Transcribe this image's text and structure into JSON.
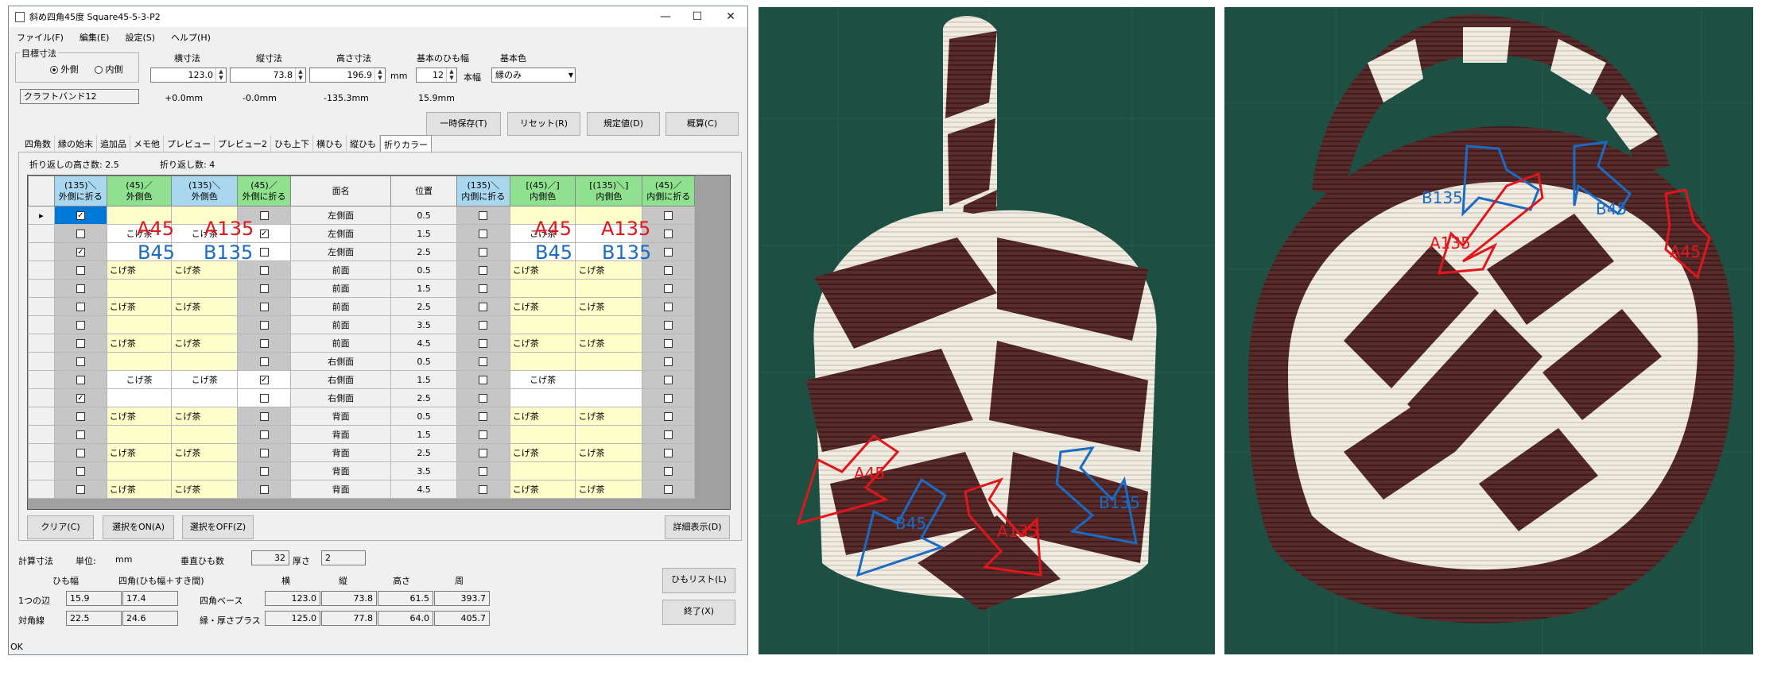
{
  "window": {
    "title": "斜め四角45度 Square45-5-3-P2",
    "min": "—",
    "max": "☐",
    "close": "✕"
  },
  "menu": [
    "ファイル(F)",
    "編集(E)",
    "設定(S)",
    "ヘルプ(H)"
  ],
  "target_group": {
    "legend": "目標寸法",
    "outer": "外側",
    "inner": "内側"
  },
  "fields": {
    "width_label": "横寸法",
    "width_value": "123.0",
    "depth_label": "縦寸法",
    "depth_value": "73.8",
    "height_label": "高さ寸法",
    "height_value": "196.9",
    "unit_mm": "mm",
    "band_label": "基本のひも幅",
    "band_value": "12",
    "band_unit": "本幅",
    "color_label": "基本色",
    "color_value": "縁のみ",
    "material": "クラフトバンド12",
    "diff_w": "+0.0mm",
    "diff_d": "-0.0mm",
    "diff_h": "-135.3mm",
    "band_mm": "15.9mm"
  },
  "buttons": {
    "save_tmp": "一時保存(T)",
    "reset": "リセット(R)",
    "default": "規定値(D)",
    "calc": "概算(C)",
    "clear": "クリア(C)",
    "sel_on": "選択をON(A)",
    "sel_off": "選択をOFF(Z)",
    "detail": "詳細表示(D)",
    "list": "ひもリスト(L)",
    "exit": "終了(X)"
  },
  "tabs": [
    "四角数",
    "縁の始末",
    "追加品",
    "メモ他",
    "プレビュー",
    "プレビュー2",
    "ひも上下",
    "横ひも",
    "縦ひも",
    "折りカラー"
  ],
  "fold_info": {
    "height_count": "折り返しの高さ数: 2.5",
    "count": "折り返し数: 4"
  },
  "grid": {
    "headers": [
      "(135)＼\n外側に折る",
      "(45)／\n外側色",
      "(135)＼\n外側色",
      "(45)／\n外側に折る",
      "面名",
      "位置",
      "(135)＼\n内側に折る",
      "[(45)／]\n内側色",
      "[(135)＼]\n内側色",
      "(45)／\n内側に折る"
    ],
    "rows": [
      {
        "c1": "",
        "f1": true,
        "oc45": "",
        "oc135": "",
        "f2": false,
        "face": "左側面",
        "pos": "0.5",
        "f3": false,
        "ic45": "",
        "ic135": "",
        "f4": false,
        "sel": true
      },
      {
        "c1": "",
        "f1": false,
        "oc45": "こげ茶",
        "oc135": "こげ茶",
        "f2": true,
        "face": "左側面",
        "pos": "1.5",
        "f3": false,
        "ic45": "こげ茶",
        "ic135": "",
        "f4": false,
        "hl": true
      },
      {
        "f1": true,
        "oc45": "",
        "oc135": "",
        "f2": false,
        "face": "左側面",
        "pos": "2.5",
        "f3": false,
        "ic45": "",
        "ic135": "",
        "f4": false,
        "hl": true
      },
      {
        "f1": false,
        "oc45": "こげ茶",
        "oc135": "こげ茶",
        "f2": false,
        "face": "前面",
        "pos": "0.5",
        "f3": false,
        "ic45": "こげ茶",
        "ic135": "こげ茶",
        "f4": false
      },
      {
        "f1": false,
        "oc45": "",
        "oc135": "",
        "f2": false,
        "face": "前面",
        "pos": "1.5",
        "f3": false,
        "ic45": "",
        "ic135": "",
        "f4": false
      },
      {
        "f1": false,
        "oc45": "こげ茶",
        "oc135": "こげ茶",
        "f2": false,
        "face": "前面",
        "pos": "2.5",
        "f3": false,
        "ic45": "こげ茶",
        "ic135": "こげ茶",
        "f4": false
      },
      {
        "f1": false,
        "oc45": "",
        "oc135": "",
        "f2": false,
        "face": "前面",
        "pos": "3.5",
        "f3": false,
        "ic45": "",
        "ic135": "",
        "f4": false
      },
      {
        "f1": false,
        "oc45": "こげ茶",
        "oc135": "こげ茶",
        "f2": false,
        "face": "前面",
        "pos": "4.5",
        "f3": false,
        "ic45": "こげ茶",
        "ic135": "こげ茶",
        "f4": false
      },
      {
        "f1": false,
        "oc45": "",
        "oc135": "",
        "f2": false,
        "face": "右側面",
        "pos": "0.5",
        "f3": false,
        "ic45": "",
        "ic135": "",
        "f4": false
      },
      {
        "f1": false,
        "oc45": "こげ茶",
        "oc135": "こげ茶",
        "f2": true,
        "face": "右側面",
        "pos": "1.5",
        "f3": false,
        "ic45": "こげ茶",
        "ic135": "",
        "f4": false,
        "hl": true
      },
      {
        "f1": true,
        "oc45": "",
        "oc135": "",
        "f2": false,
        "face": "右側面",
        "pos": "2.5",
        "f3": false,
        "ic45": "",
        "ic135": "",
        "f4": false,
        "hl": true
      },
      {
        "f1": false,
        "oc45": "こげ茶",
        "oc135": "こげ茶",
        "f2": false,
        "face": "背面",
        "pos": "0.5",
        "f3": false,
        "ic45": "こげ茶",
        "ic135": "こげ茶",
        "f4": false
      },
      {
        "f1": false,
        "oc45": "",
        "oc135": "",
        "f2": false,
        "face": "背面",
        "pos": "1.5",
        "f3": false,
        "ic45": "",
        "ic135": "",
        "f4": false
      },
      {
        "f1": false,
        "oc45": "こげ茶",
        "oc135": "こげ茶",
        "f2": false,
        "face": "背面",
        "pos": "2.5",
        "f3": false,
        "ic45": "こげ茶",
        "ic135": "こげ茶",
        "f4": false
      },
      {
        "f1": false,
        "oc45": "",
        "oc135": "",
        "f2": false,
        "face": "背面",
        "pos": "3.5",
        "f3": false,
        "ic45": "",
        "ic135": "",
        "f4": false
      },
      {
        "f1": false,
        "oc45": "こげ茶",
        "oc135": "こげ茶",
        "f2": false,
        "face": "背面",
        "pos": "4.5",
        "f3": false,
        "ic45": "こげ茶",
        "ic135": "こげ茶",
        "f4": false
      }
    ]
  },
  "annotations": {
    "a45": "A45",
    "a135": "A135",
    "b45": "B45",
    "b135": "B135"
  },
  "calc": {
    "title": "計算寸法",
    "unit_label": "単位:",
    "unit": "mm",
    "vert_label": "垂直ひも数",
    "vert_value": "32",
    "thick_label": "厚さ",
    "thick_value": "2",
    "col_band": "ひも幅",
    "col_square": "四角(ひも幅＋すき間)",
    "col_w": "横",
    "col_d": "縦",
    "col_h": "高さ",
    "col_p": "周",
    "row1_label": "1つの辺",
    "row1_band": "15.9",
    "row1_square": "17.4",
    "row2_label": "対角線",
    "row2_band": "22.5",
    "row2_square": "24.6",
    "r1_name": "四角ベース",
    "r1_w": "123.0",
    "r1_d": "73.8",
    "r1_h": "61.5",
    "r1_p": "393.7",
    "r2_name": "縁・厚さプラス",
    "r2_w": "125.0",
    "r2_d": "77.8",
    "r2_h": "64.0",
    "r2_p": "405.7"
  },
  "status": "OK",
  "colors": {
    "brown": "#5a2b2b",
    "cream": "#efeadf",
    "mat": "#1d4f43",
    "red": "#e0161c",
    "blue": "#1a6bc4"
  }
}
